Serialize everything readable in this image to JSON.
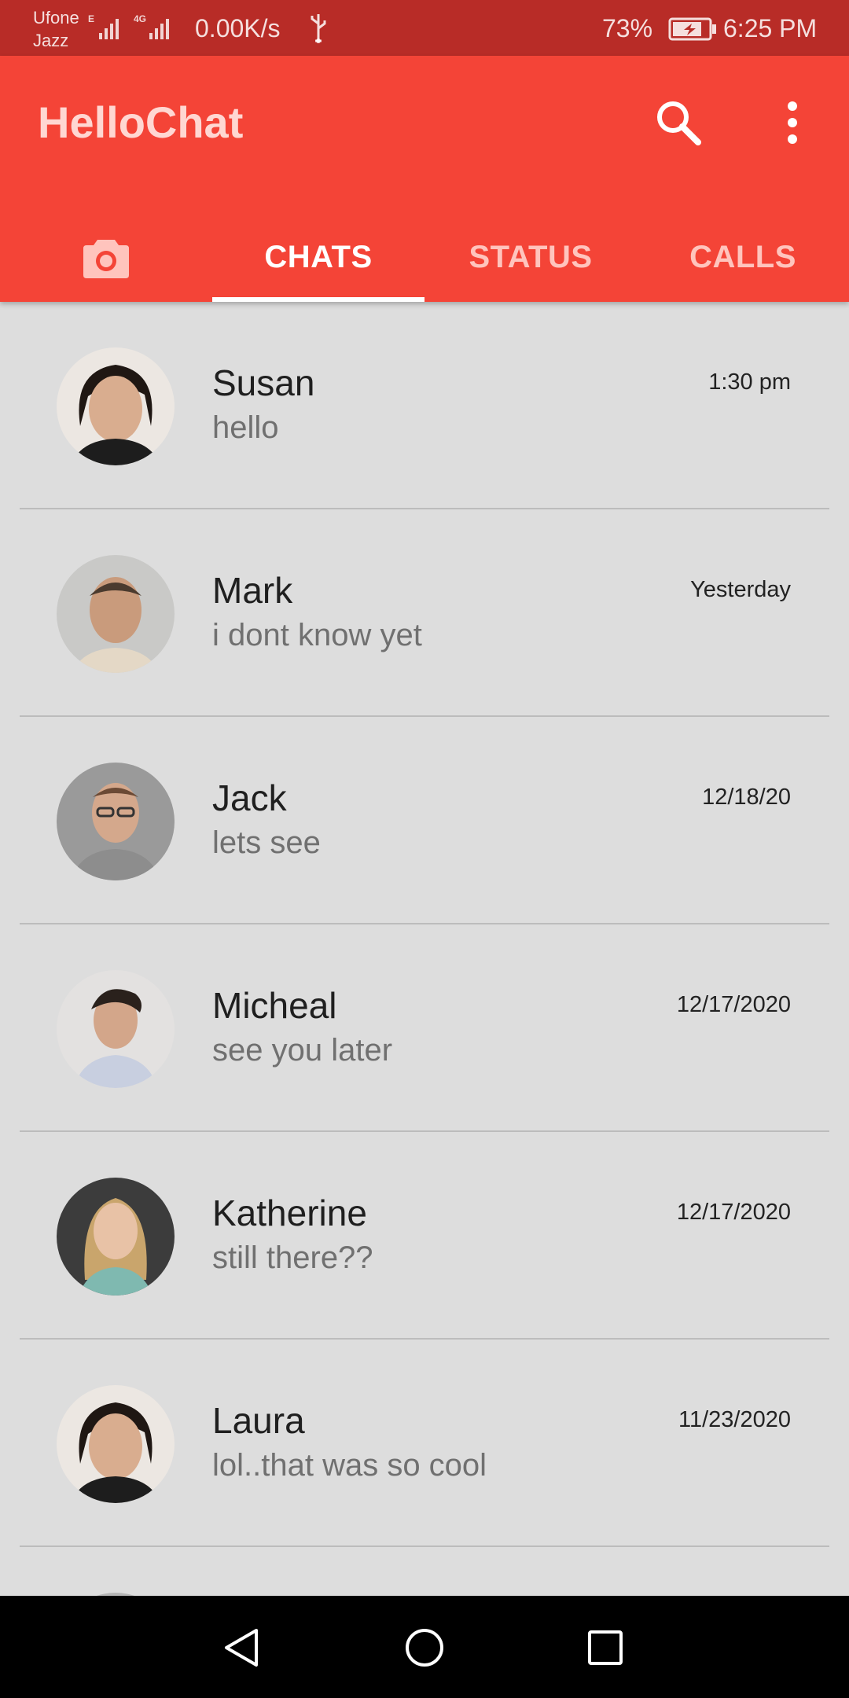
{
  "status_bar": {
    "carrier_line1": "Ufone",
    "carrier_line2": "Jazz",
    "network_speed": "0.00K/s",
    "battery_percent": "73%",
    "time": "6:25 PM",
    "icons": [
      "signal-e-icon",
      "signal-4g-icon",
      "usb-icon",
      "battery-charging-icon"
    ]
  },
  "app_bar": {
    "title": "HelloChat",
    "icons": [
      "search-icon",
      "more-vert-icon"
    ]
  },
  "tabs": {
    "camera_icon": "camera-icon",
    "items": [
      "CHATS",
      "STATUS",
      "CALLS"
    ],
    "selected": "CHATS"
  },
  "chats": [
    {
      "name": "Susan",
      "message": "hello",
      "time": "1:30 pm"
    },
    {
      "name": "Mark",
      "message": "i dont know yet",
      "time": "Yesterday"
    },
    {
      "name": "Jack",
      "message": "lets see",
      "time": "12/18/20"
    },
    {
      "name": "Micheal",
      "message": "see you later",
      "time": "12/17/2020"
    },
    {
      "name": "Katherine",
      "message": "still there??",
      "time": "12/17/2020"
    },
    {
      "name": "Laura",
      "message": "lol..that was so cool",
      "time": "11/23/2020"
    }
  ],
  "nav_bar": {
    "icons": [
      "back-icon",
      "home-icon",
      "recents-icon"
    ]
  },
  "colors": {
    "status_bar": "#b82c27",
    "app_bar": "#f44437",
    "list_background": "#dddddd",
    "divider": "#bcbcbc"
  }
}
